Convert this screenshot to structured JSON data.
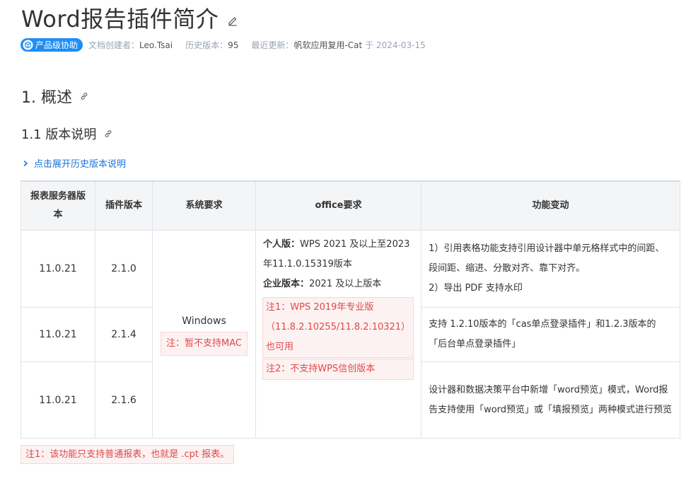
{
  "title": "Word报告插件简介",
  "meta": {
    "badge": "产品级协助",
    "creator_label": "文档创建者：",
    "creator": "Leo.Tsai",
    "history_label": "历史版本：",
    "history": "95",
    "updated_label": "最近更新：",
    "updated_by": "帆软应用复用-Cat",
    "updated_at": "于 2024-03-15"
  },
  "section1": "1. 概述",
  "section1_1": "1.1 版本说明",
  "expand_label": "点击展开历史版本说明",
  "table": {
    "headers": [
      "报表服务器版本",
      "插件版本",
      "系统要求",
      "office要求",
      "功能变动"
    ],
    "rows": [
      {
        "server": "11.0.21",
        "plugin": "2.1.0",
        "feature": "1）引用表格功能支持引用设计器中单元格样式中的间距、段间距、缩进、分散对齐、靠下对齐。",
        "feature2": "2）导出 PDF 支持水印"
      },
      {
        "server": "11.0.21",
        "plugin": "2.1.4",
        "feature": "支持 1.2.10版本的「cas单点登录插件」和1.2.3版本的「后台单点登录插件」"
      },
      {
        "server": "11.0.21",
        "plugin": "2.1.6",
        "feature": "设计器和数据决策平台中新增「word预览」模式，Word报告支持使用「word预览」或「填报预览」两种模式进行预览"
      }
    ],
    "system": "Windows",
    "system_note": "注：暂不支持MAC",
    "office_personal_label": "个人版：",
    "office_personal": "WPS 2021 及以上至2023年11.1.0.15319版本",
    "office_enterprise_label": "企业版本：",
    "office_enterprise": "2021 及以上版本",
    "office_note1": "注1：WPS 2019年专业版（11.8.2.10255/11.8.2.10321）也可用",
    "office_note2": "注2：不支持WPS信创版本"
  },
  "bottom_note": "注1：该功能只支持普通报表，也就是 .cpt 报表。",
  "colors": {
    "accent": "#1e8ef5",
    "link": "#1a73d9",
    "note_text": "#e04848",
    "note_bg": "#fdf2f2"
  }
}
